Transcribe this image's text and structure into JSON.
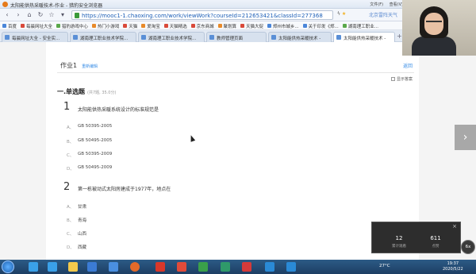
{
  "window": {
    "title": "太阳能供热采暖技术-作业 - 猎豹安全浏览器",
    "menus": [
      "文件(F)",
      "查看(V)"
    ]
  },
  "address_bar": {
    "url": "https://mooc1-1.chaoxing.com/work/viewWork?courseId=212653421&classId=277368",
    "weather": "北京雷阵天气"
  },
  "bookmarks": [
    "百度",
    "每晨网址大全",
    "猎豹游戏中心",
    "热门小游戏",
    "天猫",
    "爱淘宝",
    "天猫精选",
    "京东商城",
    "聚划算",
    "天猫大促",
    "郑州市城乡...",
    "关于印发《郑...",
    "湖南理工职业..."
  ],
  "tabs": [
    {
      "label": "每晨网址大全 - 安全实..."
    },
    {
      "label": "湖南理工职业技术学院..."
    },
    {
      "label": "湖南理工职业技术学院..."
    },
    {
      "label": "教师管理页面"
    },
    {
      "label": "太阳能供热采暖技术 -"
    },
    {
      "label": "太阳能供热采暖技术 -"
    }
  ],
  "homework": {
    "title": "作业1",
    "subtitle": "重新编辑",
    "back_label": "返回",
    "show_answer_label": "显示答案",
    "section_title": "一.单选题",
    "section_meta": "(共7题, 35.0分)"
  },
  "questions": [
    {
      "number": "1",
      "text": "太阳能供热采暖系统设计的标准规范是",
      "options": [
        {
          "letter": "A、",
          "value": "GB 50395-2005"
        },
        {
          "letter": "B、",
          "value": "GB 50495-2005"
        },
        {
          "letter": "C、",
          "value": "GB 50395-2009"
        },
        {
          "letter": "D、",
          "value": "GB 50495-2009"
        }
      ]
    },
    {
      "number": "2",
      "text": "第一栋被动式太阳房建成于1977年，地点在",
      "options": [
        {
          "letter": "A、",
          "value": "甘肃"
        },
        {
          "letter": "B、",
          "value": "青海"
        },
        {
          "letter": "C、",
          "value": "山西"
        },
        {
          "letter": "D、",
          "value": "西藏"
        }
      ]
    }
  ],
  "stats_popup": {
    "close": "×",
    "items": [
      {
        "value": "12",
        "label": "累计观看"
      },
      {
        "value": "611",
        "label": "点赞"
      }
    ],
    "badge": "6x"
  },
  "taskbar": {
    "temperature": "27°C",
    "time": "19:37",
    "date": "2020/5/22"
  }
}
